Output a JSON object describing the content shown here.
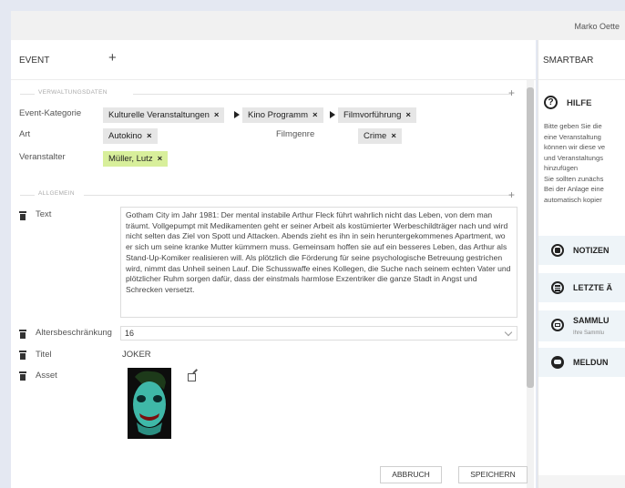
{
  "header": {
    "user_name": "Marko Oette"
  },
  "event_panel": {
    "title": "EVENT",
    "add_label": "+",
    "section_admin": "VERWALTUNGSDATEN",
    "section_general": "ALLGEMEIN",
    "section_add": "+",
    "fields": {
      "category_label": "Event-Kategorie",
      "category_path": [
        "Kulturelle Veranstaltungen",
        "Kino Programm",
        "Filmvorführung"
      ],
      "type_label": "Art",
      "type_value": "Autokino",
      "genre_label": "Filmgenre",
      "genre_value": "Crime",
      "organizer_label": "Veranstalter",
      "organizer_value": "Müller, Lutz",
      "chip_remove": "×",
      "text_label": "Text",
      "text_value": "Gotham City im Jahr 1981: Der mental instabile Arthur Fleck führt wahrlich nicht das Leben, von dem man träumt. Vollgepumpt mit Medikamenten geht er seiner Arbeit als kostümierter Werbeschildträger nach und wird nicht selten das Ziel von Spott und Attacken. Abends zieht es ihn in sein heruntergekommenes Apartment, wo er sich um seine kranke Mutter kümmern muss. Gemeinsam hoffen sie auf ein besseres Leben, das Arthur als Stand-Up-Komiker realisieren will. Als plötzlich die Förderung für seine psychologische Betreuung gestrichen wird, nimmt das Unheil seinen Lauf. Die Schusswaffe eines Kollegen, die Suche nach seinem echten Vater und plötzlicher Ruhm sorgen dafür, dass der einstmals harmlose Exzentriker die ganze Stadt in Angst und Schrecken versetzt.",
      "age_label": "Altersbeschränkung",
      "age_value": "16",
      "title_label": "Titel",
      "title_value": "JOKER",
      "asset_label": "Asset"
    },
    "buttons": {
      "cancel": "ABBRUCH",
      "save": "SPEICHERN"
    }
  },
  "smartbar": {
    "title": "SMARTBAR",
    "help": {
      "icon": "?",
      "title": "HILFE",
      "lines": [
        "Bitte geben Sie die",
        "eine Veranstaltung",
        "können wir diese ve",
        "und Veranstaltungs",
        "hinzufügen",
        "Sie sollten zunächs",
        "Bei der Anlage eine",
        "automatisch kopier"
      ]
    },
    "items": [
      {
        "label": "NOTIZEN",
        "icon": "notes-icon",
        "sub": ""
      },
      {
        "label": "LETZTE Ä",
        "icon": "list-icon",
        "sub": ""
      },
      {
        "label": "SAMMLU",
        "icon": "collection-icon",
        "sub": "Ihre Sammlu"
      },
      {
        "label": "MELDUN",
        "icon": "message-icon",
        "sub": ""
      }
    ]
  },
  "colors": {
    "chip_bg": "#e6e6e6",
    "chip_green": "#d8ef9b",
    "smartbar_item_bg": "#eef4f8",
    "page_bg": "#e4e8f2"
  }
}
